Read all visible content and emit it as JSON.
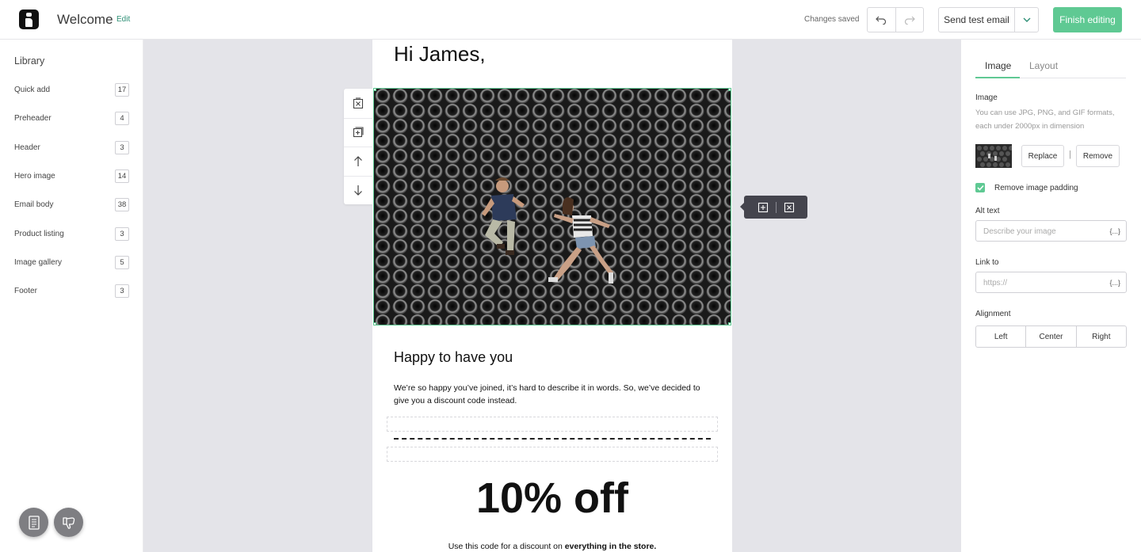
{
  "header": {
    "title": "Welcome",
    "edit_label": "Edit",
    "status": "Changes saved",
    "send_test_label": "Send test email",
    "finish_label": "Finish editing"
  },
  "library": {
    "title": "Library",
    "items": [
      {
        "label": "Quick add",
        "count": "17"
      },
      {
        "label": "Preheader",
        "count": "4"
      },
      {
        "label": "Header",
        "count": "3"
      },
      {
        "label": "Hero image",
        "count": "14"
      },
      {
        "label": "Email body",
        "count": "38"
      },
      {
        "label": "Product listing",
        "count": "3"
      },
      {
        "label": "Image gallery",
        "count": "5"
      },
      {
        "label": "Footer",
        "count": "3"
      }
    ]
  },
  "email": {
    "greeting": "Hi James,",
    "section_title": "Happy to have you",
    "body": "We’re so happy you’ve joined, it’s hard to describe it in words. So, we’ve decided to give you a discount code instead.",
    "discount": "10% off",
    "code_text_prefix": "Use this code for a discount on ",
    "code_text_bold": "everything in the store."
  },
  "panel": {
    "tabs": [
      "Image",
      "Layout"
    ],
    "active_tab": "Image",
    "image_label": "Image",
    "image_hint": "You can use JPG, PNG, and GIF formats, each under 2000px in dimension",
    "replace_label": "Replace",
    "remove_label": "Remove",
    "separator": "|",
    "remove_padding_label": "Remove image padding",
    "remove_padding_checked": true,
    "alt_text_label": "Alt text",
    "alt_text_placeholder": "Describe your image",
    "alt_text_value": "",
    "link_label": "Link to",
    "link_placeholder": "https://",
    "link_value": "",
    "merge_tag": "{...}",
    "alignment_label": "Alignment",
    "alignment_options": [
      "Left",
      "Center",
      "Right"
    ]
  },
  "colors": {
    "accent": "#5fc993",
    "canvas_bg": "#e4e4e9",
    "toolbar_dark": "#44444d"
  }
}
